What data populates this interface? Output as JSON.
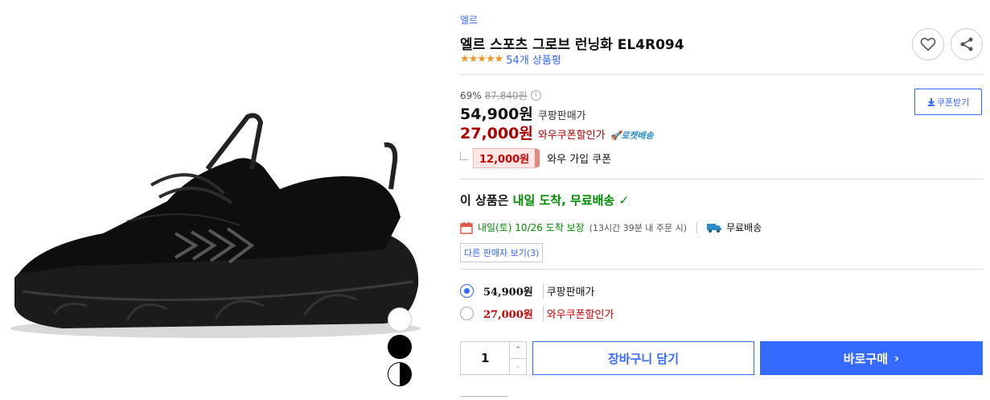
{
  "product": {
    "brand": "엘르",
    "title": "엘르 스포츠 그로브 런닝화 EL4R094",
    "stars": "★★★★★",
    "review_count": "54개 상품평"
  },
  "icons": {
    "wish": "heart-icon",
    "share": "share-icon",
    "calendar": "calendar-icon",
    "truck": "truck-icon",
    "download": "download-icon",
    "info": "info-icon"
  },
  "pricing": {
    "discount_rate": "69%",
    "original_price": "87,840원",
    "sale_price": "54,900원",
    "sale_label": "쿠팡판매가",
    "wow_price": "27,000원",
    "wow_label": "와우쿠폰할인가",
    "rocket_label": "로켓배송",
    "coupon_amount": "12,000원",
    "coupon_label": "와우 가입 쿠폰",
    "coupon_button": "쿠폰받기"
  },
  "delivery": {
    "headline_prefix": "이 상품은",
    "headline_highlight": "내일 도착, 무료배송",
    "check": "✓",
    "date_text": "내일(토) 10/26 도착 보장",
    "order_deadline": "(13시간 39분 내 주문 시)",
    "free_shipping": "무료배송",
    "other_sellers": "다른 판매자 보기(3)"
  },
  "options": [
    {
      "price": "54,900원",
      "label": "쿠팡판매가",
      "selected": true
    },
    {
      "price": "27,000원",
      "label": "와우쿠폰할인가",
      "selected": false
    }
  ],
  "purchase": {
    "quantity": "1",
    "up_arrow": "⌃",
    "down_arrow": "⌄",
    "cart_button": "장바구니 담기",
    "buy_button": "바로구매",
    "buy_arrow": "›"
  },
  "colors": {
    "accent": "#346aff",
    "discount_red": "#ae0000",
    "delivery_green": "#008c00",
    "star": "#f7931e"
  }
}
